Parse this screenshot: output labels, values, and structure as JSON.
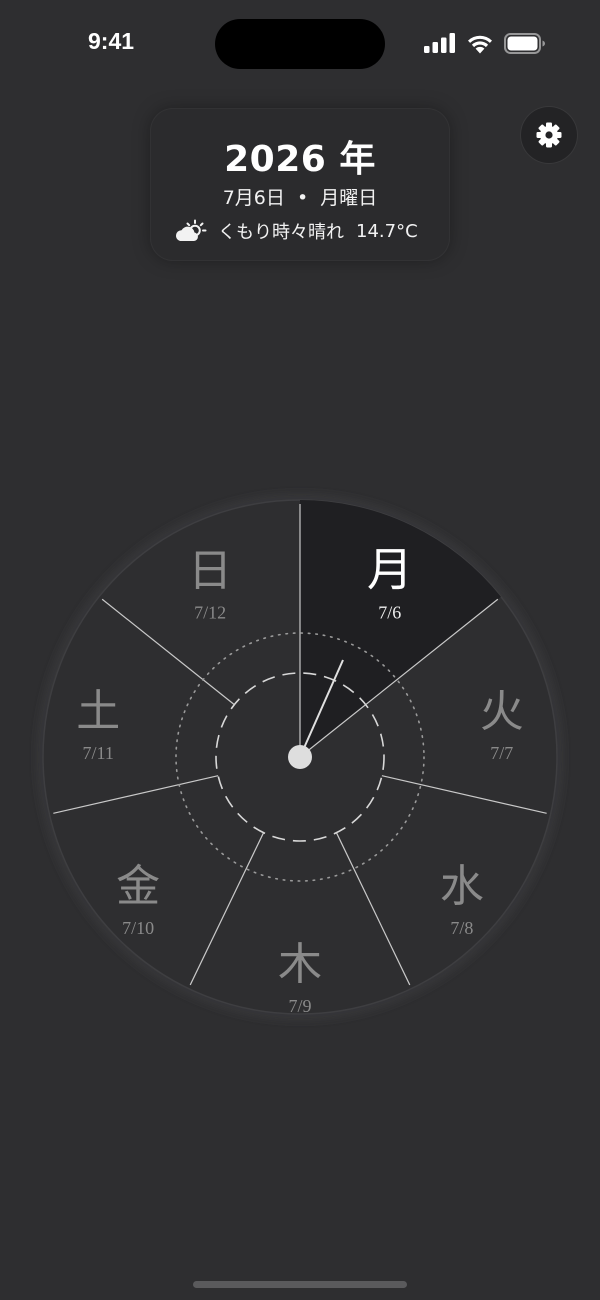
{
  "status_bar": {
    "time": "9:41"
  },
  "header": {
    "year": "2026 年",
    "date": "7月6日  •  月曜日",
    "weather_icon": "partly-cloudy-icon",
    "weather_text": "くもり時々晴れ",
    "temperature": "14.7°C"
  },
  "settings": {
    "icon": "gear-icon"
  },
  "week_dial": {
    "selected": "月",
    "days": [
      {
        "kanji": "月",
        "date": "7/6",
        "selected": true
      },
      {
        "kanji": "火",
        "date": "7/7",
        "selected": false
      },
      {
        "kanji": "水",
        "date": "7/8",
        "selected": false
      },
      {
        "kanji": "木",
        "date": "7/9",
        "selected": false
      },
      {
        "kanji": "金",
        "date": "7/10",
        "selected": false
      },
      {
        "kanji": "土",
        "date": "7/11",
        "selected": false
      },
      {
        "kanji": "日",
        "date": "7/12",
        "selected": false
      }
    ]
  },
  "colors": {
    "background": "#2e2e30",
    "selected_sector": "#1f1f22",
    "dim_text": "#8a8a8a",
    "text": "#ffffff"
  }
}
